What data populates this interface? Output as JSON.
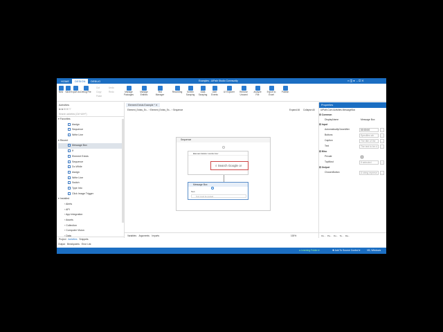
{
  "window": {
    "title": "Examples - UiPath Studio Community"
  },
  "tabs": [
    "HOME",
    "DESIGN",
    "DEBUG"
  ],
  "ribbon": {
    "buttons": [
      "New",
      "Save",
      "Export As",
      "Debug File",
      "Manage Packages",
      "Manage Entities",
      "Test Manager",
      "Recording",
      "Screen Scraping",
      "Data Scraping",
      "User Events",
      "UI Explorer",
      "Remove Unused",
      "Analyze File",
      "Export to Excel",
      "Publish"
    ],
    "small": [
      "Cut",
      "Copy",
      "Paste",
      "Undo",
      "Redo"
    ]
  },
  "activities": {
    "title": "Activities",
    "search_placeholder": "Search activities (Ctrl+Alt+F)",
    "favorites_label": "Favorites",
    "favorites": [
      "Assign",
      "Sequence",
      "Write Line"
    ],
    "recent_label": "Recent",
    "recent": [
      "Message Box",
      "If",
      "Element Exists",
      "Sequence",
      "Do While",
      "Assign",
      "Write Line",
      "Switch",
      "Type Into",
      "Click Image Trigger"
    ],
    "installed_label": "Installed",
    "installed": [
      "Alerts",
      "API",
      "App Integration",
      "Assets",
      "Collection",
      "Computer Vision",
      "Data"
    ],
    "bottom_tabs": [
      "Project",
      "Activities",
      "Snippets"
    ],
    "output_tabs": [
      "Output",
      "Breakpoints",
      "Error List"
    ]
  },
  "designer": {
    "doc_tab": "Element Exists Example *",
    "breadcrumb": [
      "Element_Exists_Ex...",
      "Element_Exists_Ex...",
      "Sequence"
    ],
    "expand_all": "Expand All",
    "collapse_all": "Collapse All",
    "sequence_label": "Sequence",
    "element_exists_label": "Element Exists 'combo box'",
    "search_preview": "Search Google or",
    "message_box_label": "Message Box",
    "text_label": "Text",
    "text_placeholder": "Text must be quoted",
    "bottom_tabs": [
      "Variables",
      "Arguments",
      "Imports"
    ],
    "zoom": "100%",
    "right_tabs": [
      "Ou...",
      "Pa...",
      "Ou...",
      "Te...",
      "Da..."
    ]
  },
  "properties": {
    "title": "Properties",
    "class": "UiPath.Core.Activities.MessageBox",
    "common_label": "Common",
    "display_name_label": "DisplayName",
    "display_name": "Message Box",
    "input_label": "Input",
    "input": [
      {
        "name": "AutomaticallyCloseAfter",
        "value": "00:00:00"
      },
      {
        "name": "Buttons",
        "value": "Specifies wh"
      },
      {
        "name": "Caption",
        "value": "The title of the"
      },
      {
        "name": "Text",
        "value": "The text to be d"
      }
    ],
    "misc_label": "Misc",
    "misc": [
      {
        "name": "Private",
        "value": ""
      },
      {
        "name": "TopMost",
        "value": "If selected"
      }
    ],
    "output_label": "Output",
    "output": [
      {
        "name": "ChosenButton",
        "value": "A string represe"
      }
    ]
  },
  "statusbar": {
    "folder": "Learning Folder",
    "source_control": "Add To Source Control",
    "target": "VB, Windows"
  }
}
